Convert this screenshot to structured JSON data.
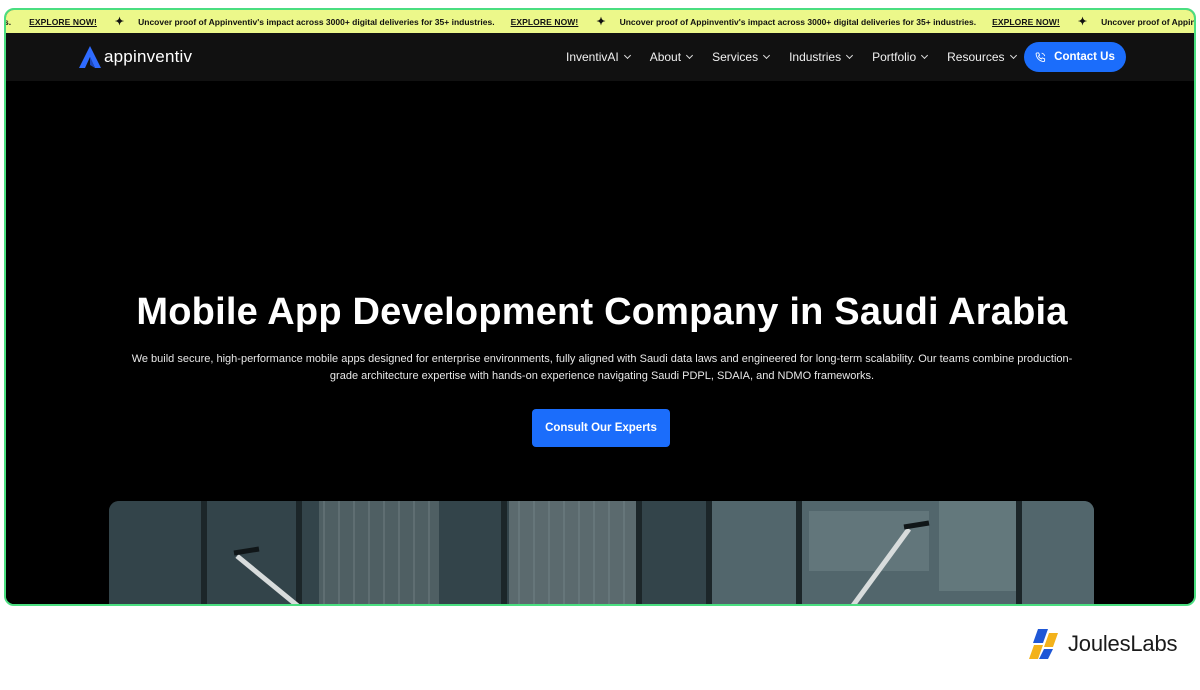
{
  "ticker": {
    "explore_label": "EXPLORE NOW!",
    "message": "Uncover proof of Appinventiv's impact across 3000+ digital deliveries for 35+ industries."
  },
  "header": {
    "logo_text": "appinventiv",
    "menu": [
      {
        "label": "InventivAI"
      },
      {
        "label": "About"
      },
      {
        "label": "Services"
      },
      {
        "label": "Industries"
      },
      {
        "label": "Portfolio"
      },
      {
        "label": "Resources"
      }
    ],
    "contact_label": "Contact Us"
  },
  "hero": {
    "title": "Mobile App Development Company in Saudi Arabia",
    "subtitle_line1": "We build secure, high-performance mobile apps designed for enterprise environments, fully aligned with Saudi data laws and engineered for long-term scalability. Our teams combine production-",
    "subtitle_line2": "grade architecture expertise with hands-on experience navigating Saudi PDPL, SDAIA, and NDMO frameworks.",
    "cta_label": "Consult Our Experts"
  },
  "watermark": {
    "brand_text": "JoulesLabs"
  },
  "colors": {
    "accent": "#1b6dfb",
    "ticker_bg": "#ecf88a",
    "frame_border": "#4ade80"
  }
}
